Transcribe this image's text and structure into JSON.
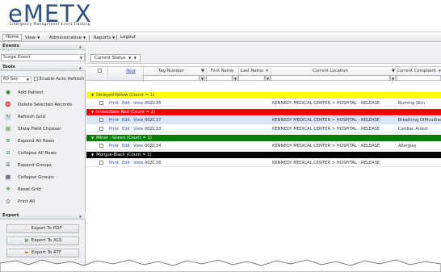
{
  "app": {
    "logo_main": "eMETX",
    "logo_sub": "Emergency Management Event Tracking"
  },
  "menu": {
    "home": "Home",
    "view": "View",
    "administrative": "Administrative",
    "reports": "Reports",
    "logout": "Logout"
  },
  "sidebar": {
    "events_title": "Events",
    "event_select": "Surge Event",
    "tools_title": "Tools",
    "refresh_interval": "60 Sec",
    "auto_refresh_label": "Enable Auto Refresh",
    "tools": [
      {
        "label": "Add Patient",
        "icon": "add-patient-icon"
      },
      {
        "label": "Delete Selected Records",
        "icon": "delete-icon"
      },
      {
        "label": "Refresh Grid",
        "icon": "refresh-icon"
      },
      {
        "label": "Show Field Chooser",
        "icon": "field-chooser-icon"
      },
      {
        "label": "Expand All Rows",
        "icon": "expand-rows-icon"
      },
      {
        "label": "Collapse All Rows",
        "icon": "collapse-rows-icon"
      },
      {
        "label": "Expand Groups",
        "icon": "expand-groups-icon"
      },
      {
        "label": "Collapse Groups",
        "icon": "collapse-groups-icon"
      },
      {
        "label": "Reset Grid",
        "icon": "reset-grid-icon"
      },
      {
        "label": "Print All",
        "icon": "print-icon"
      }
    ],
    "export_title": "Export",
    "exports": [
      {
        "label": "Export To PDF",
        "icon": "pdf-icon"
      },
      {
        "label": "Export To XLS",
        "icon": "xls-icon"
      },
      {
        "label": "Export To RTF",
        "icon": "rtf-icon"
      }
    ]
  },
  "grid": {
    "status_filter": "Current Status",
    "columns": {
      "new": "New",
      "tag_number": "Tag Number",
      "first_name": "First Name",
      "last_name": "Last Name",
      "current_location": "Current Location",
      "current_complaint": "Current Complaint"
    },
    "groups": [
      {
        "label": "Delayed-Yellow (Count = 1)",
        "color": "#ffff00",
        "text_color": "#333333",
        "rows": [
          {
            "print": "Print",
            "edit": "Edit",
            "view": "View",
            "tag": "00ZC35",
            "first": "",
            "last": "",
            "location": "KENNEDY MEDICAL CENTER > HOSPITAL - RELEASE",
            "complaint": "Burning Skin"
          }
        ]
      },
      {
        "label": "Immediate-Red (Count = 2)",
        "color": "#ff0000",
        "text_color": "#ffffff",
        "rows": [
          {
            "print": "Print",
            "edit": "Edit",
            "view": "View",
            "tag": "00ZC37",
            "first": "",
            "last": "",
            "location": "KENNEDY MEDICAL CENTER > HOSPITAL - RELEASE",
            "complaint": "Breathing Difficulties"
          },
          {
            "print": "Print",
            "edit": "Edit",
            "view": "View",
            "tag": "00ZC33",
            "first": "",
            "last": "",
            "location": "KENNEDY MEDICAL CENTER > HOSPITAL - RELEASE",
            "complaint": "Cardiac Arrest"
          }
        ]
      },
      {
        "label": "Minor - Green (Count = 1)",
        "color": "#008000",
        "text_color": "#ffffff",
        "rows": [
          {
            "print": "Print",
            "edit": "Edit",
            "view": "View",
            "tag": "00ZC34",
            "first": "",
            "last": "",
            "location": "KENNEDY MEDICAL CENTER > HOSPITAL - RELEASE",
            "complaint": "Allergies"
          }
        ]
      },
      {
        "label": "Morgue-Black (Count = 1)",
        "color": "#000000",
        "text_color": "#ffffff",
        "rows": [
          {
            "print": "Print",
            "edit": "Edit",
            "view": "View",
            "tag": "00ZC36",
            "first": "",
            "last": "",
            "location": "KENNEDY MEDICAL CENTER > HOSPITAL - RELEASE",
            "complaint": ""
          }
        ]
      }
    ]
  }
}
